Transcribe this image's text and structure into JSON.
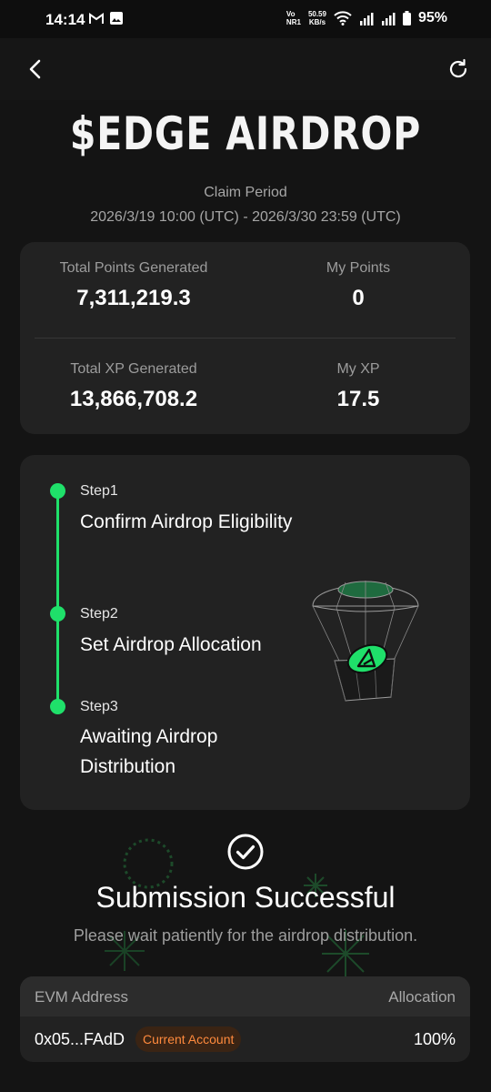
{
  "status_bar": {
    "time": "14:14",
    "network_speed_value": "50.59",
    "network_speed_unit": "KB/s",
    "volte_top": "Vo",
    "volte_bottom": "NR1",
    "battery": "95%"
  },
  "icons": {
    "back": "back-arrow-icon",
    "refresh": "refresh-icon",
    "success": "check-circle-icon"
  },
  "hero": {
    "title": "$EDGE AIRDROP",
    "claim_label": "Claim Period",
    "claim_dates": "2026/3/19 10:00 (UTC) - 2026/3/30 23:59 (UTC)"
  },
  "stats": {
    "total_points_label": "Total Points Generated",
    "total_points_value": "7,311,219.3",
    "my_points_label": "My Points",
    "my_points_value": "0",
    "total_xp_label": "Total XP Generated",
    "total_xp_value": "13,866,708.2",
    "my_xp_label": "My XP",
    "my_xp_value": "17.5"
  },
  "steps": [
    {
      "num": "Step1",
      "title": "Confirm Airdrop Eligibility"
    },
    {
      "num": "Step2",
      "title": "Set Airdrop Allocation"
    },
    {
      "num": "Step3",
      "title": "Awaiting Airdrop Distribution"
    }
  ],
  "success": {
    "title": "Submission Successful",
    "subtitle": "Please wait patiently for the airdrop distribution."
  },
  "allocation_table": {
    "col_address": "EVM Address",
    "col_allocation": "Allocation",
    "address": "0x05...FAdD",
    "badge": "Current Account",
    "allocation": "100%"
  },
  "colors": {
    "accent_green": "#1fe06a",
    "badge_orange": "#ff8a3d",
    "background": "#141414",
    "card": "#222222"
  }
}
